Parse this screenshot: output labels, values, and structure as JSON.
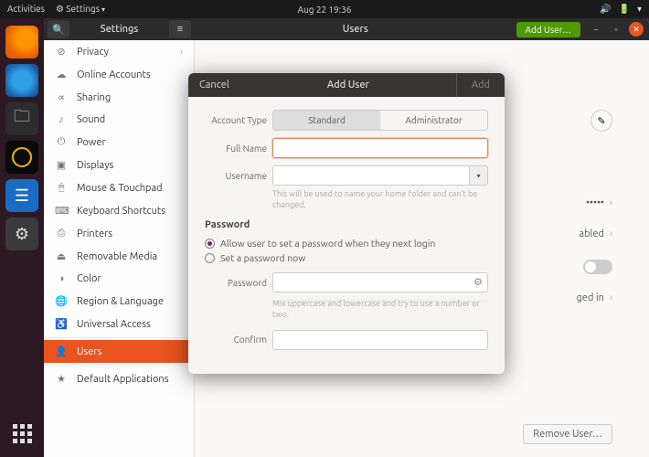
{
  "topbar": {
    "activities": "Activities",
    "app_menu": "Settings",
    "datetime": "Aug 22  19:36"
  },
  "window": {
    "title_left": "Settings",
    "title_right": "Users",
    "add_user_btn": "Add User…"
  },
  "sidebar": {
    "items": [
      {
        "icon": "⊘",
        "label": "Privacy",
        "chev": true
      },
      {
        "icon": "☁",
        "label": "Online Accounts"
      },
      {
        "icon": "∝",
        "label": "Sharing"
      },
      {
        "icon": "♪",
        "label": "Sound"
      },
      {
        "icon": "⏻",
        "label": "Power"
      },
      {
        "icon": "▣",
        "label": "Displays"
      },
      {
        "icon": "🖱",
        "label": "Mouse & Touchpad"
      },
      {
        "icon": "⌨",
        "label": "Keyboard Shortcuts"
      },
      {
        "icon": "⎙",
        "label": "Printers"
      },
      {
        "icon": "⏏",
        "label": "Removable Media"
      },
      {
        "icon": "◑",
        "label": "Color"
      },
      {
        "icon": "🌐",
        "label": "Region & Language"
      },
      {
        "icon": "♿",
        "label": "Universal Access"
      },
      {
        "icon": "👤",
        "label": "Users",
        "active": true
      },
      {
        "icon": "★",
        "label": "Default Applications"
      }
    ]
  },
  "content": {
    "rows": {
      "password_dots": "•••••",
      "autologin": "abled",
      "activity": "ged in"
    },
    "remove_btn": "Remove User…"
  },
  "dialog": {
    "cancel": "Cancel",
    "title": "Add User",
    "add": "Add",
    "account_type_label": "Account Type",
    "account_type_standard": "Standard",
    "account_type_admin": "Administrator",
    "fullname_label": "Full Name",
    "username_label": "Username",
    "username_hint": "This will be used to name your home folder and can't be changed.",
    "password_section": "Password",
    "radio_next_login": "Allow user to set a password when they next login",
    "radio_set_now": "Set a password now",
    "password_label": "Password",
    "password_hint": "Mix uppercase and lowercase and try to use a number or two.",
    "confirm_label": "Confirm"
  }
}
